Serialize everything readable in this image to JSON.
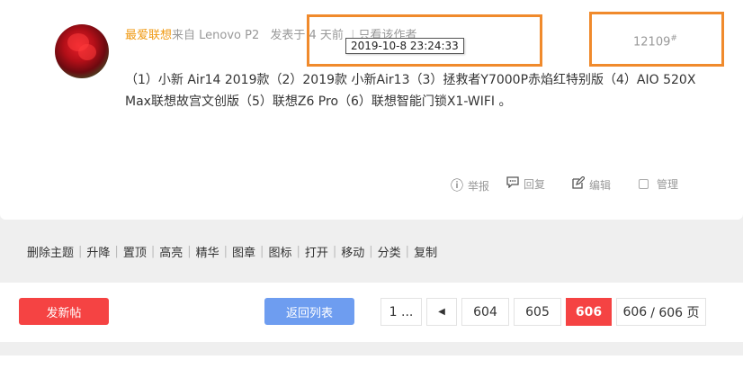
{
  "post": {
    "author": "最爱联想",
    "from_text": "来自 Lenovo P2",
    "posted_text": "发表于 4 天前",
    "only_author": "只看该作者",
    "tooltip_time": "2019-10-8 23:24:33",
    "floor_number": "12109",
    "floor_mark": "#",
    "content": "（1）小新 Air14 2019款（2）2019款 小新Air13（3）拯救者Y7000P赤焰红特别版（4）AIO 520X Max联想故宫文创版（5）联想Z6 Pro（6）联想智能门锁X1-WIFI 。",
    "actions": {
      "report": "举报",
      "reply": "回复",
      "edit": "编辑",
      "manage": "管理"
    }
  },
  "moderation": [
    "删除主题",
    "升降",
    "置顶",
    "高亮",
    "精华",
    "图章",
    "图标",
    "打开",
    "移动",
    "分类",
    "复制"
  ],
  "bottom": {
    "new_post": "发新帖",
    "back_to_list": "返回列表",
    "pager": {
      "first": "1 ...",
      "pages": [
        "604",
        "605"
      ],
      "current": "606",
      "jump_value": "606",
      "total": "/ 606 页"
    }
  },
  "colors": {
    "accent_red": "#f54343",
    "author_orange": "#f09a13",
    "back_blue": "#6e9df0",
    "highlight_orange": "#f08a2c"
  }
}
